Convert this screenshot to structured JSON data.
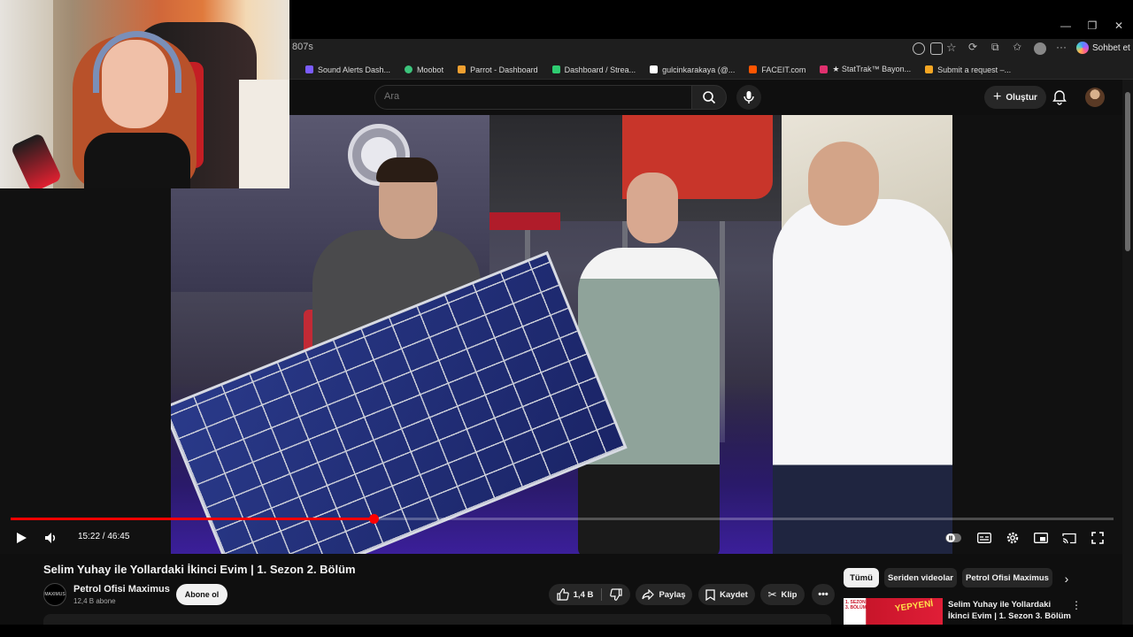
{
  "browser": {
    "address_text": "807s",
    "sohbet_label": "Sohbet et",
    "bookmarks": [
      {
        "label": "Sound Alerts Dash...",
        "color": "#7b5cff"
      },
      {
        "label": "Moobot",
        "color": "#3cc47c"
      },
      {
        "label": "Parrot - Dashboard",
        "color": "#f0a030"
      },
      {
        "label": "Dashboard / Strea...",
        "color": "#2ecc71"
      },
      {
        "label": "gulcinkarakaya (@...",
        "color": "#ffffff"
      },
      {
        "label": "FACEIT.com",
        "color": "#ff5500"
      },
      {
        "label": "★ StatTrak™ Bayon...",
        "color": "#e0306e"
      },
      {
        "label": "Submit a request –...",
        "color": "#f5a623"
      }
    ]
  },
  "yt_header": {
    "search_placeholder": "Ara",
    "create_label": "Oluştur"
  },
  "player": {
    "time_display": "15:22 / 46:45",
    "progress": 0.329,
    "accent": "#ff0000"
  },
  "video_info": {
    "title": "Selim Yuhay ile Yollardaki İkinci Evim | 1. Sezon 2. Bölüm",
    "channel_name": "Petrol Ofisi Maximus",
    "channel_avatar_text": "MAXIMUS",
    "subscribers": "12,4 B abone",
    "subscribe_label": "Abone ol",
    "like_count": "1,4 B",
    "share_label": "Paylaş",
    "save_label": "Kaydet",
    "clip_label": "Klip"
  },
  "chips": [
    "Tümü",
    "Seriden videolar",
    "Petrol Ofisi Maximus"
  ],
  "recommendation": {
    "title": "Selim Yuhay ile Yollardaki İkinci Evim | 1. Sezon 3. Bölüm",
    "thumb_badge": "1. SEZON 3. BÖLÜM",
    "thumb_tag": "YEPYENİ"
  }
}
